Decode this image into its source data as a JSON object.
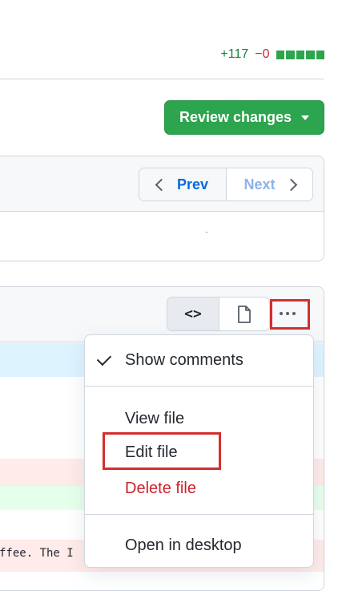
{
  "diffstat": {
    "additions": "+117",
    "deletions": "−0",
    "blocks": 5
  },
  "toolbar": {
    "review_label": "Review changes"
  },
  "pager": {
    "prev_label": "Prev",
    "next_label": "Next"
  },
  "file_header": {
    "code_label": "<>"
  },
  "code": {
    "line_text": "ffee. The I"
  },
  "menu": {
    "show_comments": "Show comments",
    "view_file": "View file",
    "edit_file": "Edit file",
    "delete_file": "Delete file",
    "open_desktop": "Open in desktop"
  },
  "colors": {
    "accent_green": "#2da44e",
    "link_blue": "#0969da",
    "danger_red": "#cf222e",
    "highlight_red": "#d22f2f"
  }
}
